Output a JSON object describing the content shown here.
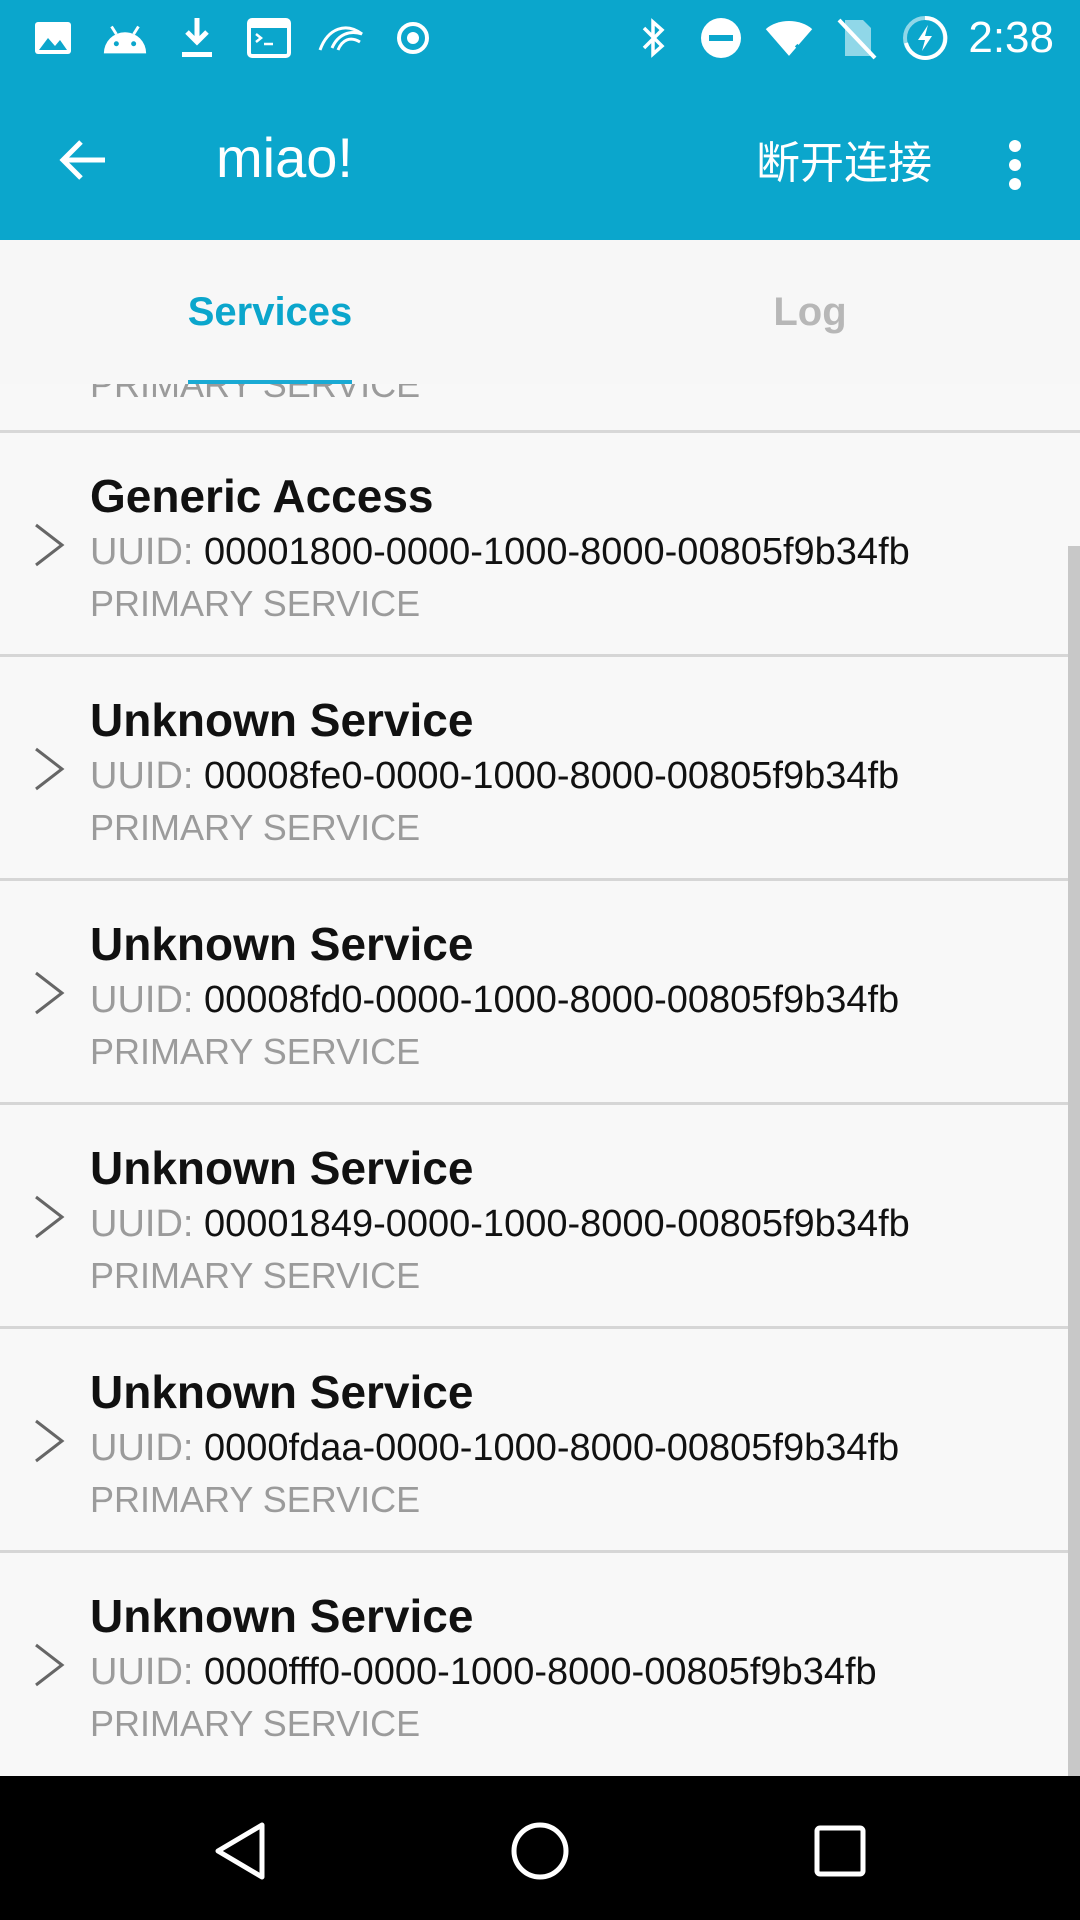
{
  "status_bar": {
    "time": "2:38",
    "left_icons": [
      "image-icon",
      "android-icon",
      "download-icon",
      "terminal-icon",
      "app-logo-icon",
      "record-icon"
    ],
    "right_icons": [
      "bluetooth-icon",
      "do-not-disturb-icon",
      "wifi-icon",
      "no-sim-icon",
      "battery-charging-icon"
    ]
  },
  "app_bar": {
    "title": "miao!",
    "disconnect_label": "断开连接",
    "back_icon": "arrow-back-icon",
    "more_icon": "more-vert-icon"
  },
  "tabs": {
    "services_label": "Services",
    "log_label": "Log",
    "active": "Services"
  },
  "list": {
    "partial_top_type": "PRIMARY SERVICE",
    "uuid_label": "UUID:",
    "services": [
      {
        "name": "Generic Access",
        "uuid": "00001800-0000-1000-8000-00805f9b34fb",
        "type": "PRIMARY SERVICE"
      },
      {
        "name": "Unknown Service",
        "uuid": "00008fe0-0000-1000-8000-00805f9b34fb",
        "type": "PRIMARY SERVICE"
      },
      {
        "name": "Unknown Service",
        "uuid": "00008fd0-0000-1000-8000-00805f9b34fb",
        "type": "PRIMARY SERVICE"
      },
      {
        "name": "Unknown Service",
        "uuid": "00001849-0000-1000-8000-00805f9b34fb",
        "type": "PRIMARY SERVICE"
      },
      {
        "name": "Unknown Service",
        "uuid": "0000fdaa-0000-1000-8000-00805f9b34fb",
        "type": "PRIMARY SERVICE"
      },
      {
        "name": "Unknown Service",
        "uuid": "0000fff0-0000-1000-8000-00805f9b34fb",
        "type": "PRIMARY SERVICE"
      }
    ]
  },
  "colors": {
    "primary": "#0ba6cc",
    "tab_active": "#0ba6cc",
    "tab_inactive": "#b7b7b7",
    "secondary_text": "#9b9b9b"
  }
}
